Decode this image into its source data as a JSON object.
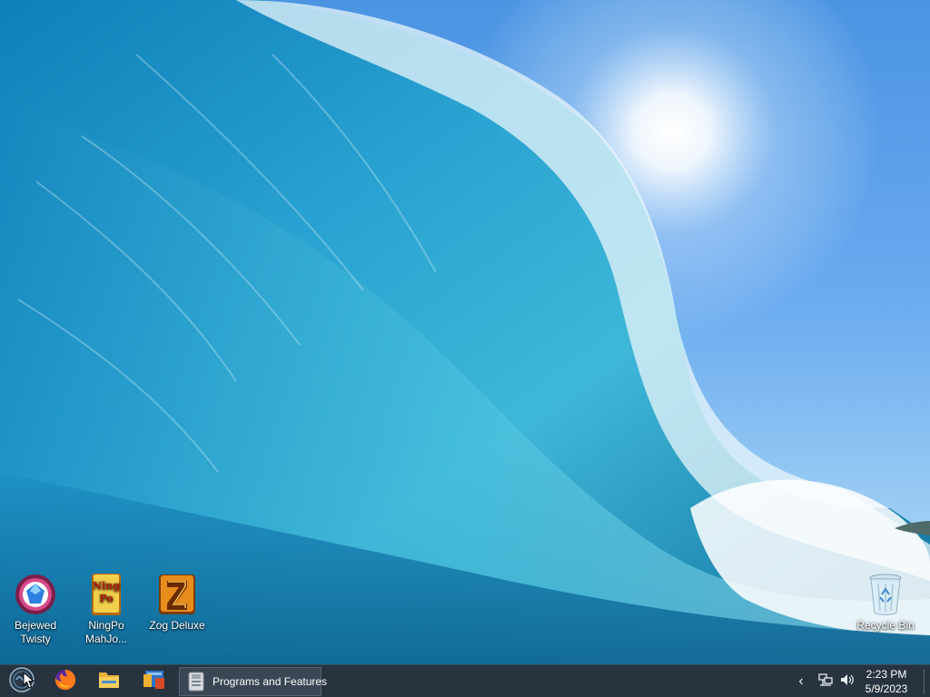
{
  "desktop": {
    "icons": [
      {
        "label": "Bejewed Twisty",
        "icon": "bejeweled-twist-icon"
      },
      {
        "label": "NingPo MahJo...",
        "icon": "ningpo-mahjong-icon"
      },
      {
        "label": "Zog Deluxe",
        "icon": "zog-deluxe-icon"
      },
      {
        "label": "Recycle Bin",
        "icon": "recycle-bin-icon"
      }
    ],
    "ningpo_icon_text": "Ning Po"
  },
  "taskbar": {
    "start_icon": "start-orb-icon",
    "pinned": [
      {
        "name": "Firefox",
        "icon": "firefox-icon"
      },
      {
        "name": "File Explorer",
        "icon": "folder-icon"
      },
      {
        "name": "Windows Explorer",
        "icon": "windows-explorer-icon"
      }
    ],
    "active_task": {
      "label": "Programs and Features",
      "icon": "programs-features-icon"
    },
    "tray": {
      "chevron": "‹",
      "network_icon": "network-icon",
      "volume_icon": "volume-icon"
    },
    "clock": {
      "time": "2:23 PM",
      "date": "5/9/2023"
    }
  },
  "colors": {
    "taskbar": "#27333f",
    "sky": "#4b94e2",
    "wave": "#1d8fc0"
  }
}
